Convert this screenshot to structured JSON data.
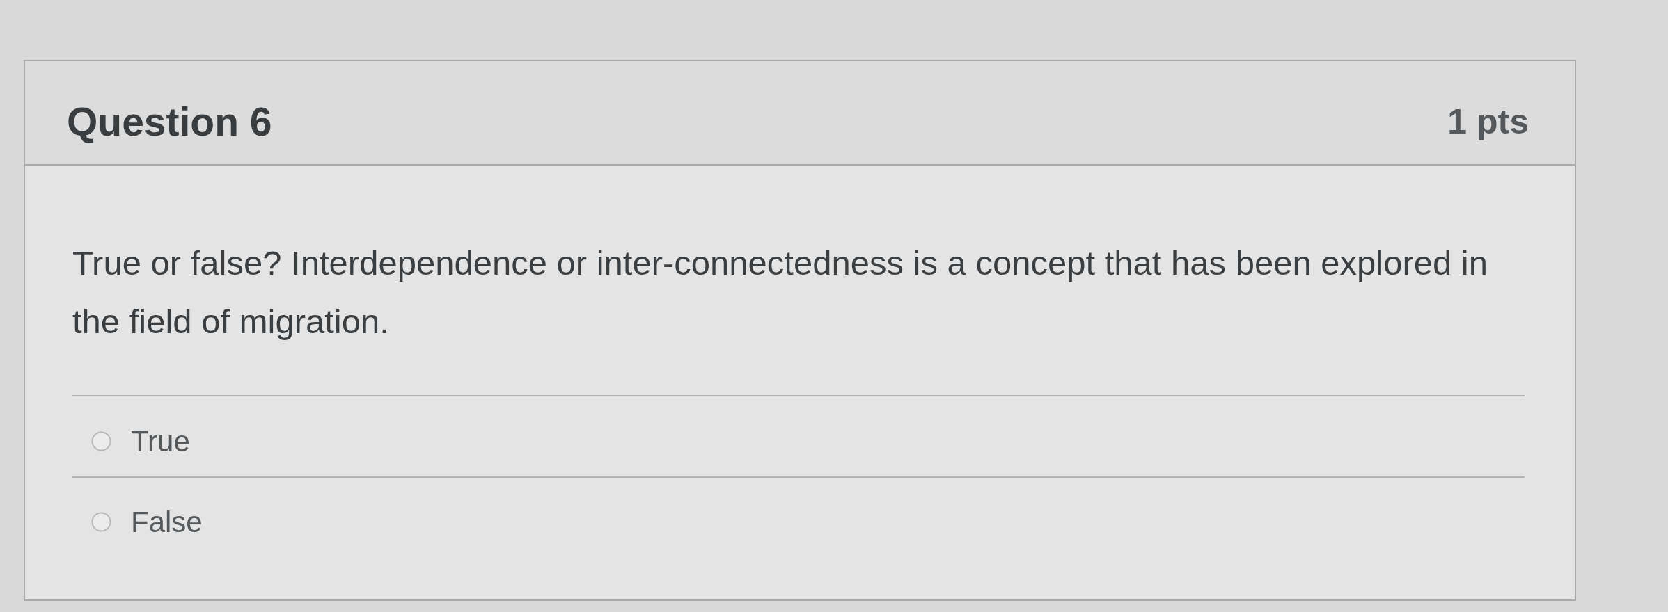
{
  "question": {
    "title": "Question 6",
    "points": "1 pts",
    "text": "True or false? Interdependence or inter-connectedness is a concept that has been explored in the field of migration.",
    "answers": [
      {
        "label": "True",
        "selected": false
      },
      {
        "label": "False",
        "selected": false
      }
    ]
  }
}
